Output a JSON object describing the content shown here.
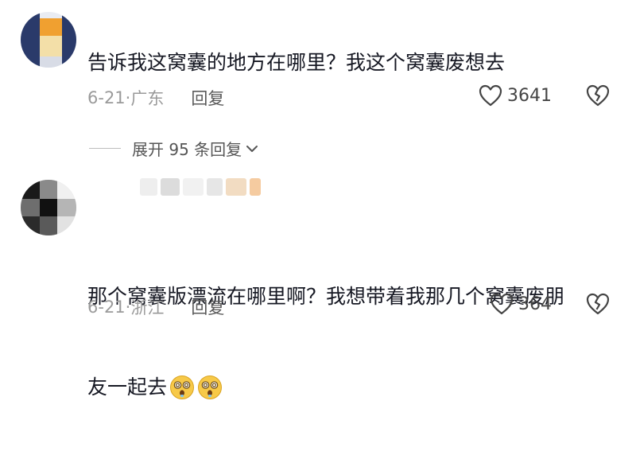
{
  "comments": [
    {
      "text": "告诉我这窝囊的地方在哪里？我这个窝囊废想去",
      "date": "6-21",
      "location": "广东",
      "reply_label": "回复",
      "likes": "3641"
    },
    {
      "text_line1": "那个窝囊版漂流在哪里啊？我想带着我那几个窝囊废朋",
      "text_line2": "友一起去",
      "date": "6-21",
      "location": "浙江",
      "reply_label": "回复",
      "likes": "364"
    }
  ],
  "expand_replies": {
    "label": "展开 95 条回复"
  },
  "colors": {
    "text": "#161823",
    "meta": "#9a9a9a",
    "avatar1_orange": "#f0a030",
    "avatar1_navy": "#2a3a6a",
    "avatar1_cream": "#f3dfa8"
  },
  "icons": {
    "like": "heart-outline-icon",
    "dislike": "broken-heart-icon",
    "expand": "chevron-down-icon",
    "emoji": "dizzy-face-emoji"
  }
}
